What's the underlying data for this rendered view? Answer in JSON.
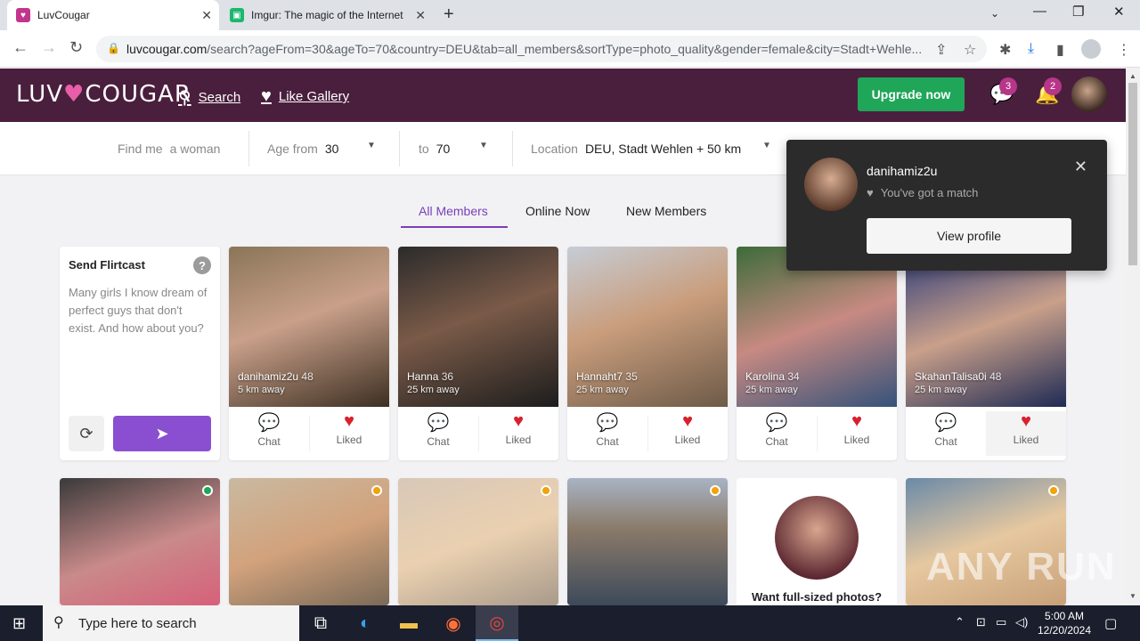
{
  "browser": {
    "tabs": [
      {
        "title": "LuvCougar",
        "favicon_color": "#c2358d"
      },
      {
        "title": "Imgur: The magic of the Internet",
        "favicon_color": "#1bb76e"
      }
    ],
    "url_host": "luvcougar.com",
    "url_path": "/search?ageFrom=30&ageTo=70&country=DEU&tab=all_members&sortType=photo_quality&gender=female&city=Stadt+Wehle..."
  },
  "header": {
    "logo_left": "LUV",
    "logo_right": "COUGAR",
    "search_label": "Search",
    "like_gallery_label": "Like Gallery",
    "upgrade_label": "Upgrade now",
    "messages_badge": "3",
    "notifications_badge": "2"
  },
  "filters": {
    "find_me_label": "Find me",
    "find_me_value": "a woman",
    "age_from_label": "Age from",
    "age_from_value": "30",
    "to_label": "to",
    "to_value": "70",
    "location_label": "Location",
    "location_value": "DEU, Stadt Wehlen + 50 km"
  },
  "member_tabs": [
    "All Members",
    "Online Now",
    "New Members"
  ],
  "flirtcast": {
    "title": "Send Flirtcast",
    "help": "?",
    "text": "Many girls I know dream of perfect guys that don't exist. And how about you?"
  },
  "actions": {
    "chat": "Chat",
    "liked": "Liked"
  },
  "members_row1": [
    {
      "name": "danihamiz2u",
      "age": "48",
      "distance": "5 km away"
    },
    {
      "name": "Hanna",
      "age": "36",
      "distance": "25 km away"
    },
    {
      "name": "Hannaht7",
      "age": "35",
      "distance": "25 km away"
    },
    {
      "name": "Karolina",
      "age": "34",
      "distance": "25 km away"
    },
    {
      "name": "SkahanTalisa0i",
      "age": "48",
      "distance": "25 km away"
    }
  ],
  "promo": {
    "text": "Want full-sized photos?"
  },
  "notification": {
    "username": "danihamiz2u",
    "message": "You've got a match",
    "button": "View profile"
  },
  "watermark": "ANY RUN",
  "taskbar": {
    "search_placeholder": "Type here to search",
    "time": "5:00 AM",
    "date": "12/20/2024"
  },
  "colors": {
    "header_bg": "#4a1f3d",
    "accent": "#7a3fb8",
    "upgrade": "#1fa658",
    "like_red": "#d8202e",
    "online_green": "#1fa658",
    "recent_orange": "#f0a30a"
  }
}
